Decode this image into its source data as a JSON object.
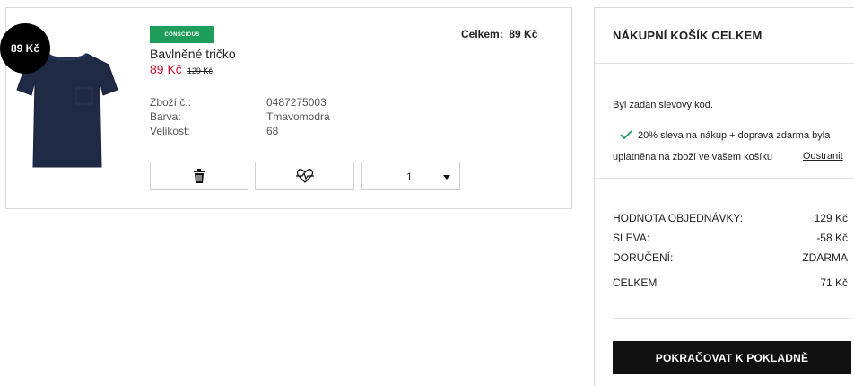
{
  "item": {
    "badge_price": "89 Kč",
    "tag": "CONSCIOUS",
    "name": "Bavlněné tričko",
    "price_current": "89 Kč",
    "price_old": "129 Kč",
    "total_label": "Celkem:",
    "total_value": "89 Kč",
    "attributes": [
      {
        "label": "Zboží č.:",
        "value": "0487275003"
      },
      {
        "label": "Barva:",
        "value": "Tmavomodrá"
      },
      {
        "label": "Velikost:",
        "value": "68"
      }
    ],
    "image_icon": "navy-tshirt-image",
    "quantity": "1"
  },
  "summary": {
    "title": "NÁKUPNÍ KOŠÍK CELKEM",
    "discount_heading": "Byl zadán slevový kód.",
    "discount_line1": "20% sleva na nákup + doprava zdarma byla",
    "discount_line2": "uplatněna na zboží ve vašem košíku",
    "remove_label": "Odstranit",
    "rows": [
      {
        "label": "HODNOTA OBJEDNÁVKY:",
        "value": "129 Kč"
      },
      {
        "label": "SLEVA:",
        "value": "-58 Kč"
      },
      {
        "label": "DORUČENÍ:",
        "value": "ZDARMA"
      },
      {
        "label": "CELKEM",
        "value": "71 Kč"
      }
    ],
    "checkout_label": "POKRAČOVAT K POKLADNĚ"
  },
  "colors": {
    "accent_green": "#1f9e5a",
    "sale_red": "#c8102e",
    "button_dark": "#111111"
  }
}
